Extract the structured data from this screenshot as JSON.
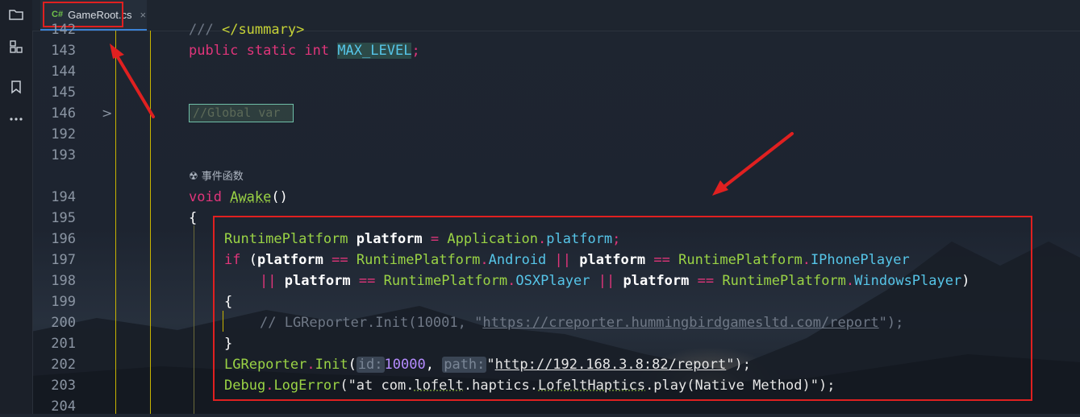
{
  "tab": {
    "lang_badge": "C#",
    "file_name": "GameRoot.cs",
    "close_glyph": "×"
  },
  "activity_bar": {
    "icons": [
      "folder-icon",
      "structure-icon",
      "bookmark-icon",
      "more-icon"
    ]
  },
  "gutter": {
    "fold_glyph": ">"
  },
  "editor": {
    "line_numbers": [
      "142",
      "143",
      "144",
      "145",
      "146",
      "192",
      "193",
      "194",
      "195",
      "196",
      "197",
      "198",
      "199",
      "200",
      "201",
      "202",
      "203",
      "204"
    ],
    "line142": {
      "t1": "///",
      "t2": "</summary>"
    },
    "line143": {
      "t1": "public",
      "t2": "static",
      "t3": "int",
      "t4": "MAX_LEVEL",
      "t5": ";"
    },
    "line146_region": "//Global var",
    "codelens": "☢ 事件函数",
    "line194": {
      "t1": "void",
      "t2": "Awake",
      "t3": "()"
    },
    "line195": "{",
    "line196": {
      "t1": "RuntimePlatform",
      "t2": "platform",
      "t3": "=",
      "t4": "Application",
      "t5": ".",
      "t6": "platform",
      "t7": ";"
    },
    "line197": {
      "t1": "if",
      "t2": "(",
      "t3": "platform",
      "t4": "==",
      "t5": "RuntimePlatform",
      "t6": ".",
      "t7": "Android",
      "t8": "||",
      "t9": "platform",
      "t10": "==",
      "t11": "RuntimePlatform",
      "t12": ".",
      "t13": "IPhonePlayer"
    },
    "line198": {
      "t1": "||",
      "t2": "platform",
      "t3": "==",
      "t4": "RuntimePlatform",
      "t5": ".",
      "t6": "OSXPlayer",
      "t7": "||",
      "t8": "platform",
      "t9": "==",
      "t10": "RuntimePlatform",
      "t11": ".",
      "t12": "WindowsPlayer",
      "t13": ")"
    },
    "line199": "{",
    "line200": {
      "t1": "// LGReporter.Init(10001, \"",
      "t2": "https://creporter.hummingbirdgamesltd.com/report",
      "t3": "\");"
    },
    "line201": "}",
    "line202": {
      "t1": "LGReporter",
      "t2": ".",
      "t3": "Init",
      "t4": "(",
      "t5": "id:",
      "t6": "10000",
      "t7": ",",
      "t8": "path:",
      "t9": "\"",
      "t10": "http://192.168.3.8:82/report",
      "t11": "\");"
    },
    "line203": {
      "t1": "Debug",
      "t2": ".",
      "t3": "LogError",
      "t4": "(\"at com.",
      "t5": "lofelt",
      "t6": ".haptics.",
      "t7": "LofeltHaptics",
      "t8": ".play(Native Method)\");"
    }
  },
  "colors": {
    "keyword": "#e0357a",
    "type": "#9ad345",
    "member": "#56c5e8",
    "number": "#b58cff",
    "annotation": "#e02020"
  }
}
